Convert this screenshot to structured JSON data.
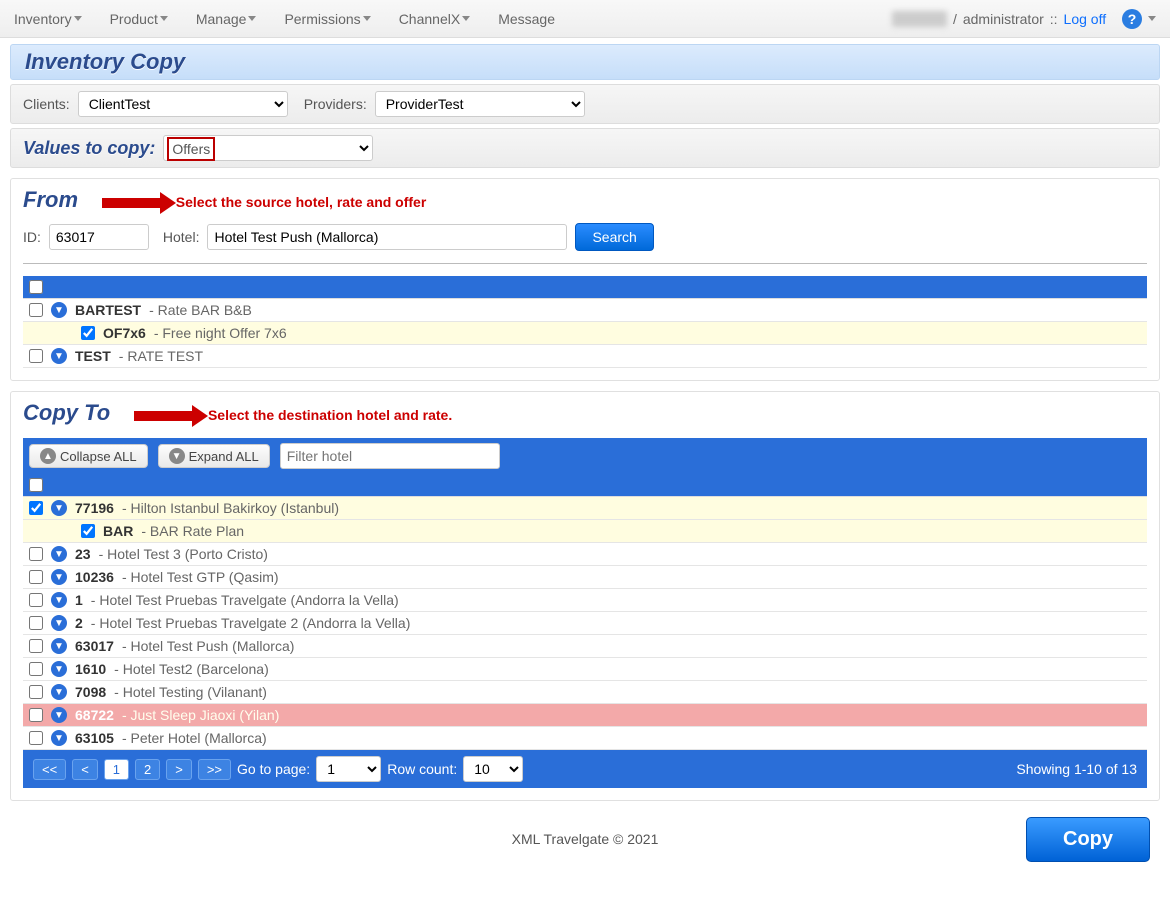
{
  "topnav": {
    "items": [
      "Inventory",
      "Product",
      "Manage",
      "Permissions",
      "ChannelX",
      "Message"
    ],
    "user_sep": " / ",
    "user_role": "administrator",
    "sep": " :: ",
    "logoff": "Log off"
  },
  "page_title": "Inventory Copy",
  "filters": {
    "clients_label": "Clients:",
    "clients_value": "ClientTest",
    "providers_label": "Providers:",
    "providers_value": "ProviderTest",
    "values_label": "Values to copy:",
    "values_value": "Offers"
  },
  "from": {
    "heading": "From",
    "hint": "Select the source hotel, rate and offer",
    "id_label": "ID:",
    "id_value": "63017",
    "hotel_label": "Hotel:",
    "hotel_value": "Hotel Test Push (Mallorca)",
    "search": "Search",
    "rows": [
      {
        "checked": false,
        "code": "BARTEST",
        "sep": " - ",
        "name": "Rate BAR B&B"
      },
      {
        "checked": true,
        "indent": 1,
        "sel": true,
        "code": "OF7x6",
        "sep": " - ",
        "name": "Free night Offer 7x6"
      },
      {
        "checked": false,
        "code": "TEST",
        "sep": " - ",
        "name": "RATE TEST"
      }
    ]
  },
  "to": {
    "heading": "Copy To",
    "hint": "Select the destination hotel and rate.",
    "collapse": "Collapse ALL",
    "expand": "Expand ALL",
    "filter_placeholder": "Filter hotel",
    "rows": [
      {
        "checked": true,
        "sel": true,
        "code": "77196",
        "sep": " - ",
        "name": "Hilton Istanbul Bakirkoy (Istanbul)"
      },
      {
        "checked": true,
        "sel": true,
        "indent": 1,
        "code": "BAR",
        "sep": " - ",
        "name": "BAR Rate Plan"
      },
      {
        "checked": false,
        "code": "23",
        "sep": " - ",
        "name": "Hotel Test 3 (Porto Cristo)"
      },
      {
        "checked": false,
        "code": "10236",
        "sep": " - ",
        "name": "Hotel Test GTP (Qasim)"
      },
      {
        "checked": false,
        "code": "1",
        "sep": " - ",
        "name": "Hotel Test Pruebas Travelgate (Andorra la Vella)"
      },
      {
        "checked": false,
        "code": "2",
        "sep": " - ",
        "name": "Hotel Test Pruebas Travelgate 2 (Andorra la Vella)"
      },
      {
        "checked": false,
        "code": "63017",
        "sep": " - ",
        "name": "Hotel Test Push (Mallorca)"
      },
      {
        "checked": false,
        "code": "1610",
        "sep": " - ",
        "name": "Hotel Test2 (Barcelona)"
      },
      {
        "checked": false,
        "code": "7098",
        "sep": " - ",
        "name": "Hotel Testing (Vilanant)"
      },
      {
        "checked": false,
        "red": true,
        "code": "68722",
        "sep": " - ",
        "name": "Just Sleep Jiaoxi (Yilan)"
      },
      {
        "checked": false,
        "code": "63105",
        "sep": " - ",
        "name": "Peter Hotel (Mallorca)"
      }
    ]
  },
  "pager": {
    "first": "<<",
    "prev": "<",
    "pages": [
      "1",
      "2"
    ],
    "next": ">",
    "last": ">>",
    "goto_label": "Go to page:",
    "goto_value": "1",
    "rowcount_label": "Row count:",
    "rowcount_value": "10",
    "showing": "Showing 1-10 of 13"
  },
  "footer": {
    "copyright": "XML Travelgate © 2021",
    "copy_btn": "Copy"
  }
}
